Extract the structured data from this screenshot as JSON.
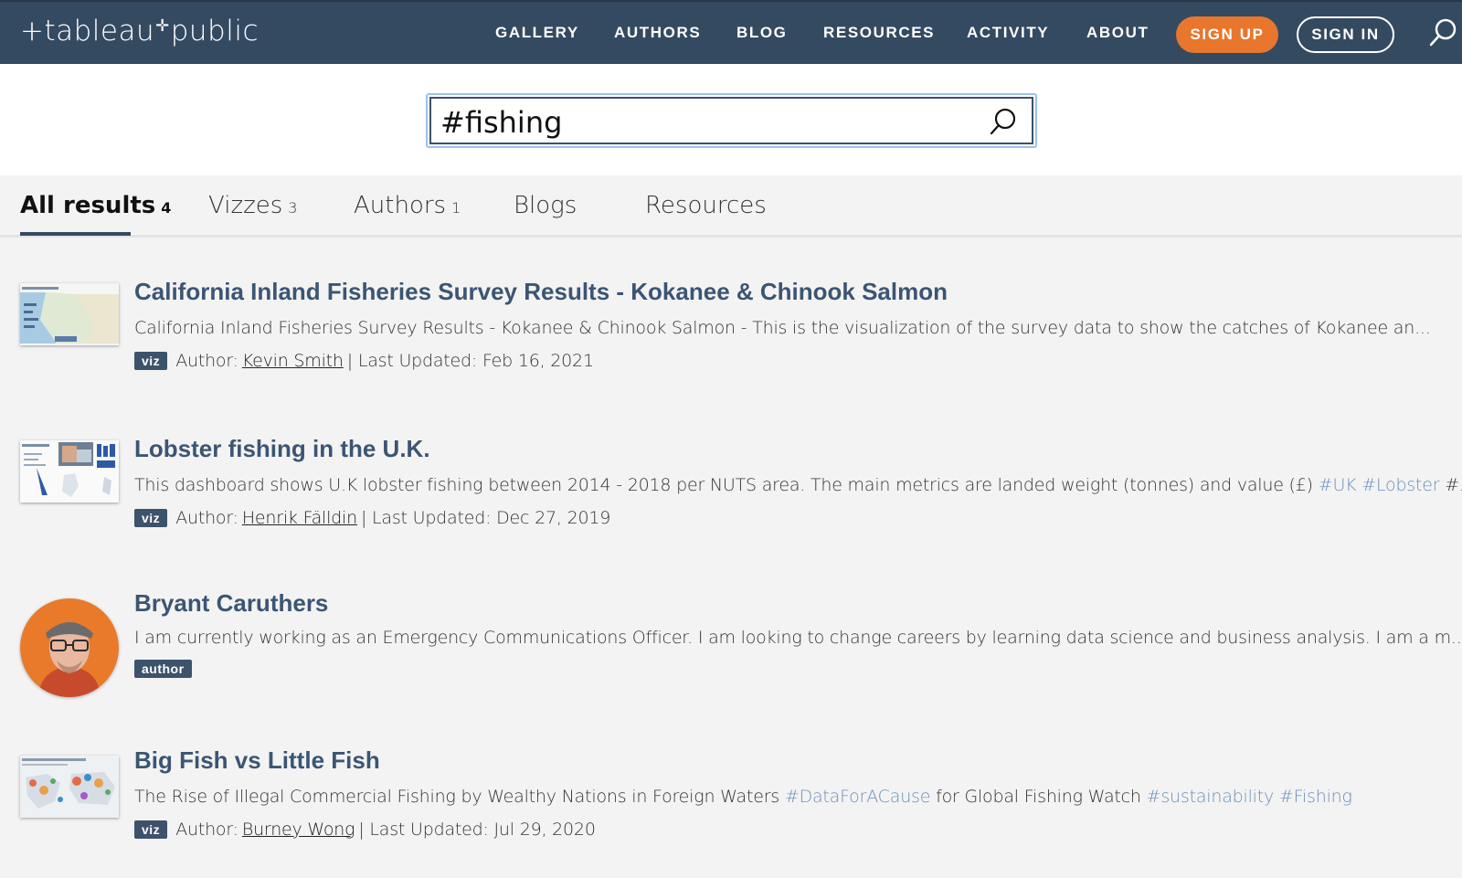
{
  "header": {
    "logo": "+tableau+public",
    "logo_parts": [
      "+tableau",
      "public"
    ],
    "nav": [
      "GALLERY",
      "AUTHORS",
      "BLOG",
      "RESOURCES",
      "ACTIVITY",
      "ABOUT"
    ],
    "signup": "SIGN UP",
    "signin": "SIGN IN",
    "colors": {
      "bg": "#344a61",
      "signup": "#e8762d"
    }
  },
  "search": {
    "value": "#fishing"
  },
  "tabs": [
    {
      "label": "All results",
      "count": "4",
      "active": true
    },
    {
      "label": "Vizzes",
      "count": "3"
    },
    {
      "label": "Authors",
      "count": "1"
    },
    {
      "label": "Blogs",
      "count": ""
    },
    {
      "label": "Resources",
      "count": ""
    }
  ],
  "results": [
    {
      "title": "California Inland Fisheries Survey Results - Kokanee & Chinook Salmon",
      "description": "California Inland Fisheries Survey Results - Kokanee & Chinook Salmon - This is the visualization of the survey data to show the catches of Kokanee an...",
      "badge": "viz",
      "author_prefix": "Author:",
      "author": "Kevin Smith",
      "updated": "| Last Updated: Feb 16, 2021"
    },
    {
      "title": "Lobster fishing in the U.K.",
      "description": "This dashboard shows U.K lobster fishing between 2014 - 2018 per NUTS area. The main metrics are landed weight (tonnes) and value (£)",
      "tags": [
        "#UK",
        "#Lobster"
      ],
      "trail": "#...",
      "badge": "viz",
      "author_prefix": "Author:",
      "author": "Henrik Fälldin",
      "updated": "| Last Updated: Dec 27, 2019"
    },
    {
      "title": "Bryant Caruthers",
      "description": "I am currently working as an Emergency Communications Officer. I am looking to change careers by learning data science and business analysis. I am a m...",
      "badge": "author"
    },
    {
      "title": "Big Fish vs Little Fish",
      "description_parts": [
        "The Rise of Illegal Commercial Fishing by Wealthy Nations in Foreign Waters",
        "#DataForACause",
        "for Global Fishing Watch",
        "#sustainability",
        "#Fishing"
      ],
      "badge": "viz",
      "author_prefix": "Author:",
      "author": "Burney Wong",
      "updated": "| Last Updated: Jul 29, 2020"
    }
  ]
}
